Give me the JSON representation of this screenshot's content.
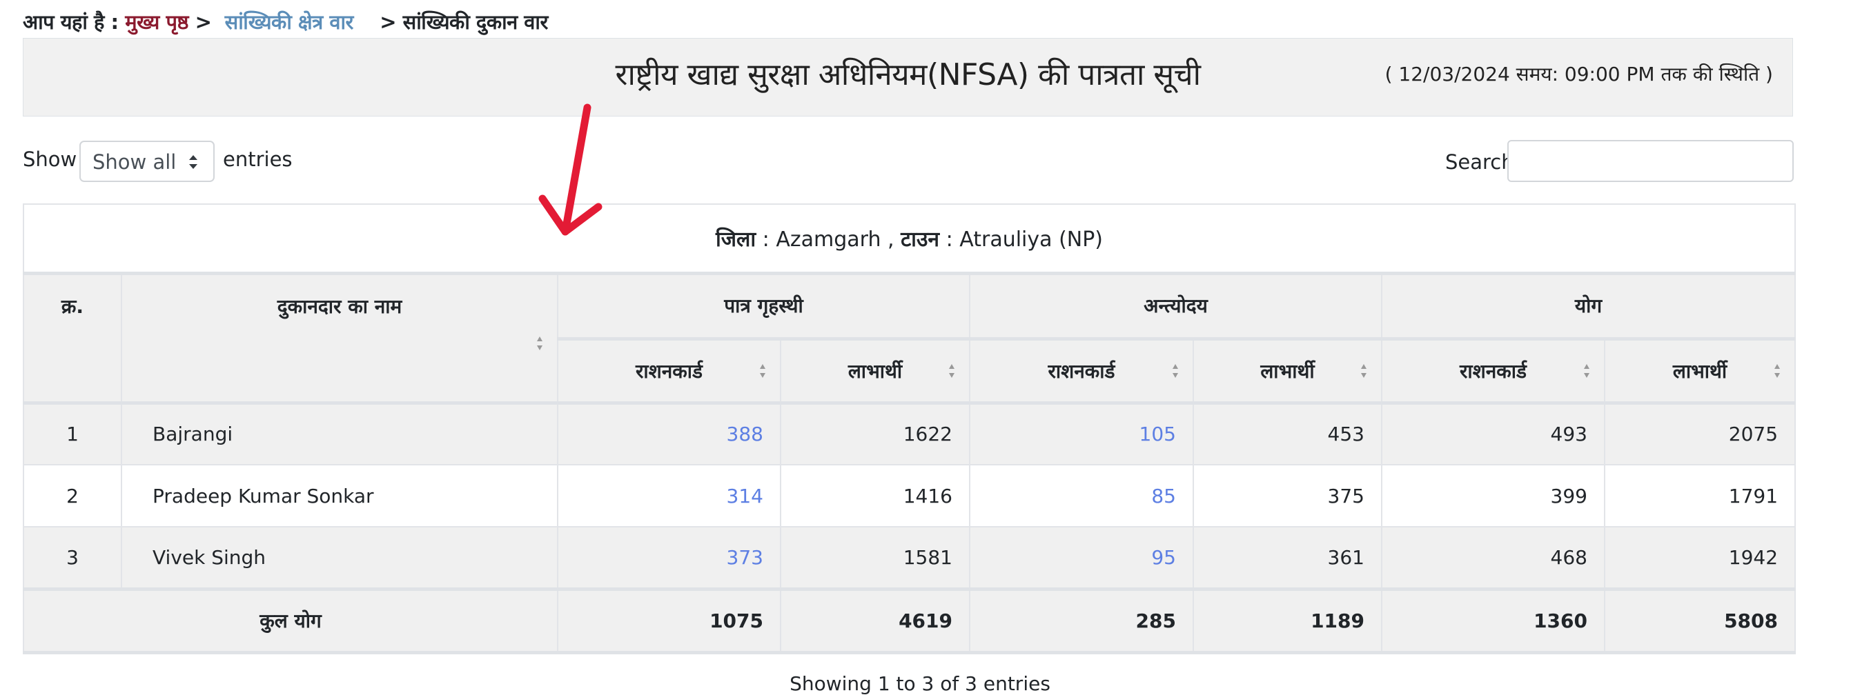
{
  "breadcrumb": {
    "prefix": "आप यहां है : ",
    "items": [
      {
        "label": "मुख्य पृष्ठ",
        "color": "#8b1a2e"
      },
      {
        "label": "सांख्यिकी क्षेत्र वार",
        "color": "#5b8db8"
      },
      {
        "label": "सांख्यिकी दुकान वार",
        "color": "#212529"
      }
    ],
    "separator": ">"
  },
  "header": {
    "title": "राष्ट्रीय खाद्य सुरक्षा अधिनियम(NFSA) की पात्रता सूची",
    "status": "( 12/03/2024 समय: 09:00 PM तक की स्थिति )"
  },
  "controls": {
    "show_label": "Show",
    "length_select_value": "Show all",
    "entries_label": "entries",
    "search_label": "Search:",
    "search_value": ""
  },
  "table": {
    "caption": {
      "district_label": "जिला",
      "district_value": "Azamgarh",
      "town_label": "टाउन",
      "town_value": "Atrauliya (NP)"
    },
    "headers": {
      "serial": "क्र.",
      "dealer_name": "दुकानदार का नाम",
      "groups": [
        "पात्र गृहस्थी",
        "अन्त्योदय",
        "योग"
      ],
      "sub": [
        "राशनकार्ड",
        "लाभार्थी",
        "राशनकार्ड",
        "लाभार्थी",
        "राशनकार्ड",
        "लाभार्थी"
      ]
    },
    "rows": [
      {
        "sn": "1",
        "name": "Bajrangi",
        "phh_cards": "388",
        "phh_beneficiaries": "1622",
        "aay_cards": "105",
        "aay_beneficiaries": "453",
        "total_cards": "493",
        "total_beneficiaries": "2075"
      },
      {
        "sn": "2",
        "name": "Pradeep Kumar Sonkar",
        "phh_cards": "314",
        "phh_beneficiaries": "1416",
        "aay_cards": "85",
        "aay_beneficiaries": "375",
        "total_cards": "399",
        "total_beneficiaries": "1791"
      },
      {
        "sn": "3",
        "name": "Vivek Singh",
        "phh_cards": "373",
        "phh_beneficiaries": "1581",
        "aay_cards": "95",
        "aay_beneficiaries": "361",
        "total_cards": "468",
        "total_beneficiaries": "1942"
      }
    ],
    "footer": {
      "label": "कुल योग",
      "phh_cards": "1075",
      "phh_beneficiaries": "4619",
      "aay_cards": "285",
      "aay_beneficiaries": "1189",
      "total_cards": "1360",
      "total_beneficiaries": "5808"
    }
  },
  "info_text": "Showing 1 to 3 of 3 entries",
  "colors": {
    "link_number": "#5d7fe3",
    "annotation_arrow": "#e31b35",
    "header_bg": "#f1f1f1"
  },
  "icons": {
    "select_caret": "up-down-caret-icon",
    "sort": "sort-both-icon",
    "annotation": "red-arrow-annotation-icon"
  }
}
